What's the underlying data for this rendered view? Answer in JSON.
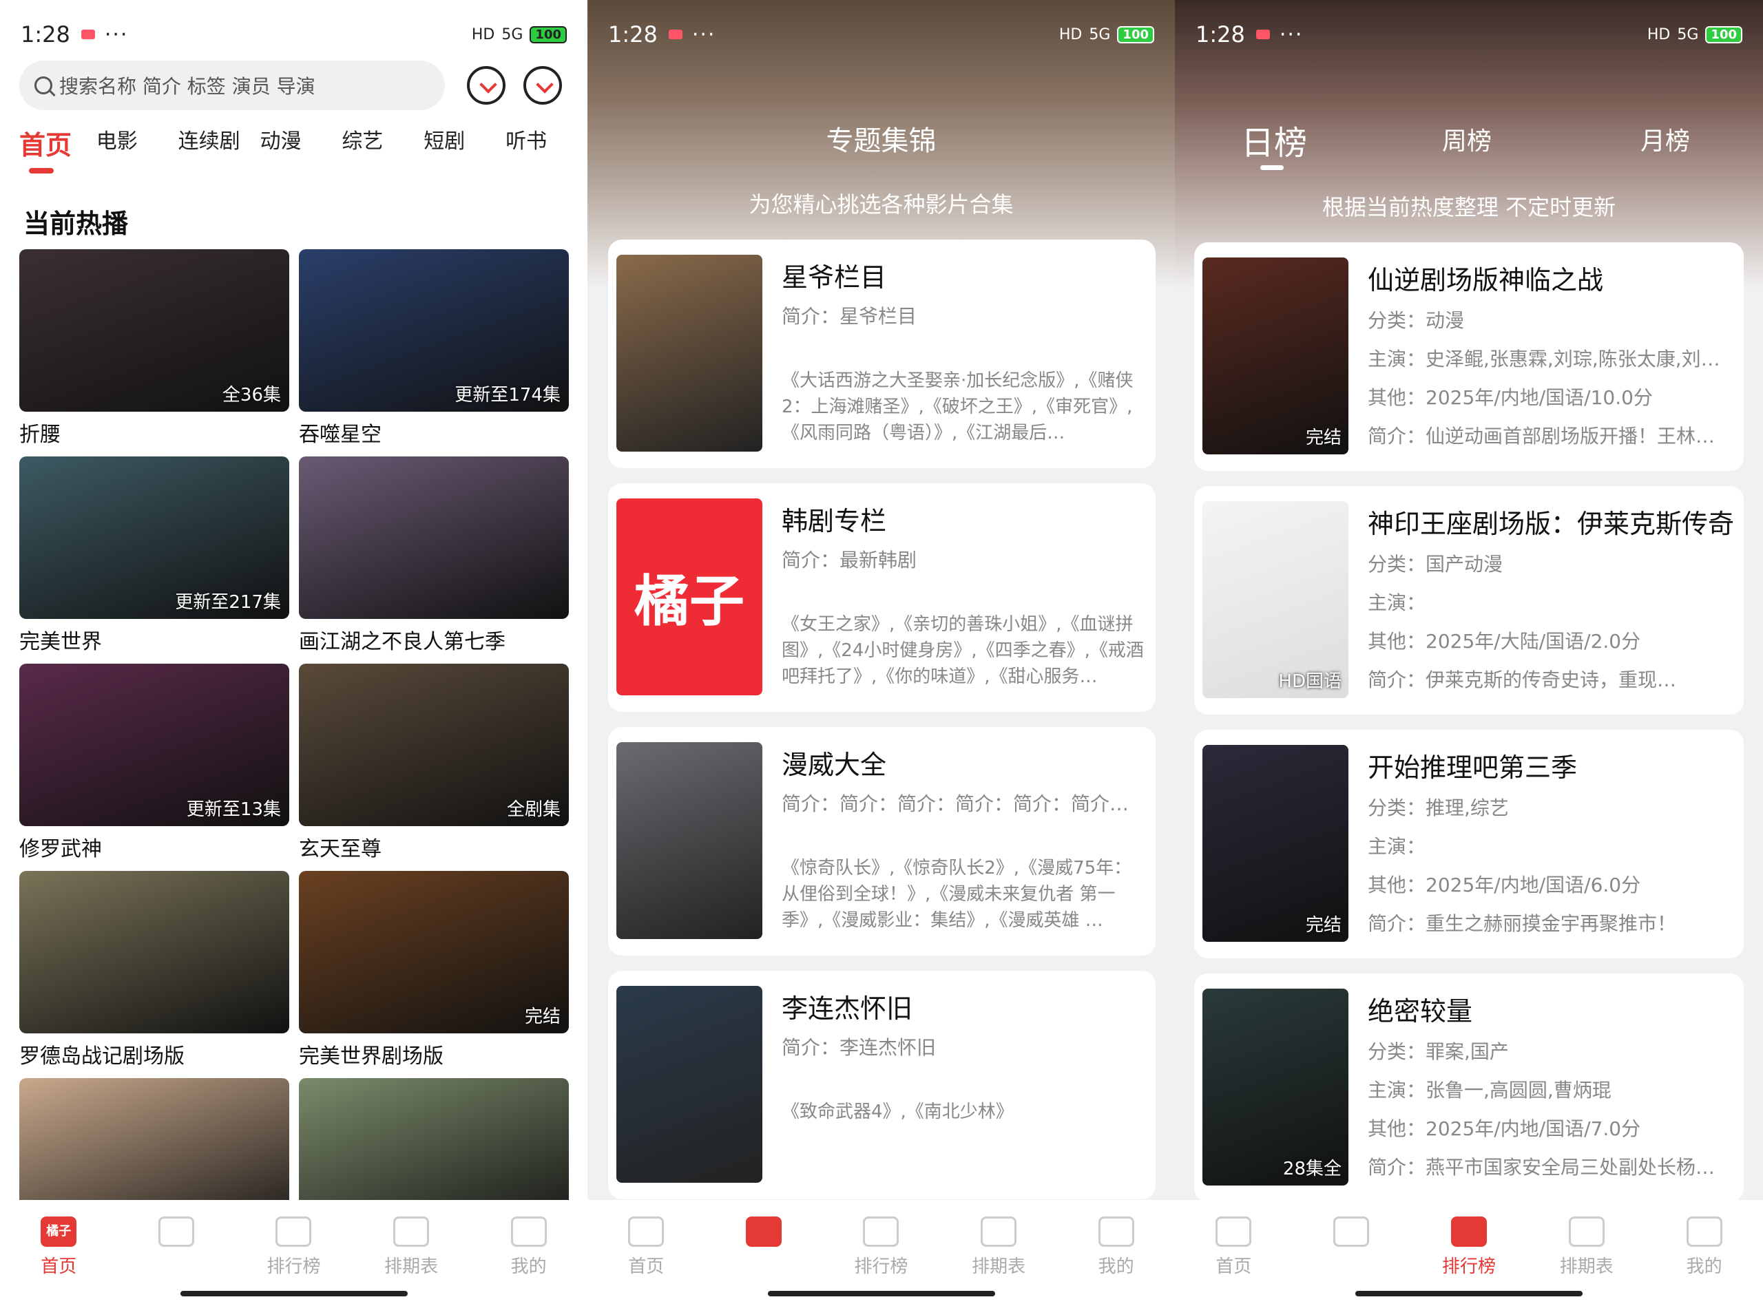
{
  "status": {
    "time": "1:28",
    "dots": "···",
    "battery": "100",
    "hd": "HD",
    "sig": "5G"
  },
  "home": {
    "search_placeholder": "搜索名称 简介 标签 演员 导演",
    "categories": [
      "首页",
      "电影",
      "连续剧",
      "动漫",
      "综艺",
      "短剧",
      "听书"
    ],
    "section_title": "当前热播",
    "items": [
      {
        "name": "折腰",
        "badge": "全36集",
        "color": "#3a2f35"
      },
      {
        "name": "吞噬星空",
        "badge": "更新至174集",
        "color": "#2a3f6a"
      },
      {
        "name": "完美世界",
        "badge": "更新至217集",
        "color": "#3d5a63"
      },
      {
        "name": "画江湖之不良人第七季",
        "badge": "",
        "color": "#6a5a74"
      },
      {
        "name": "修罗武神",
        "badge": "更新至13集",
        "color": "#5a2a4a"
      },
      {
        "name": "玄天至尊",
        "badge": "全剧集",
        "color": "#5a4a3a"
      },
      {
        "name": "罗德岛战记剧场版",
        "badge": "",
        "color": "#7a7358"
      },
      {
        "name": "完美世界剧场版",
        "badge": "完结",
        "color": "#6a4020"
      },
      {
        "name": "",
        "badge": "",
        "color": "#c9a98c"
      },
      {
        "name": "",
        "badge": "",
        "color": "#7a8a6a"
      }
    ]
  },
  "topics": {
    "title": "专题集锦",
    "subtitle": "为您精心挑选各种影片合集",
    "items": [
      {
        "title": "星爷栏目",
        "intro": "简介：星爷栏目",
        "list": "《大话西游之大圣娶亲·加长纪念版》,《赌侠2：上海滩赌圣》,《破坏之王》,《审死官》,《风雨同路（粤语）》,《江湖最后…",
        "color": "#8a6a4a"
      },
      {
        "title": "韩剧专栏",
        "intro": "简介：最新韩剧",
        "list": "《女王之家》,《亲切的善珠小姐》,《血谜拼图》,《24小时健身房》,《四季之春》,《戒酒吧拜托了》,《你的味道》,《甜心服务…",
        "logo": "橘子",
        "color": "#ef2b35"
      },
      {
        "title": "漫威大全",
        "intro": "简介：简介：简介：简介：简介：简介…",
        "list": "《惊奇队长》,《惊奇队长2》,《漫威75年：从俚俗到全球！》,《漫威未来复仇者 第一季》,《漫威影业：集结》,《漫威英雄 …",
        "color": "#6a6a70"
      },
      {
        "title": "李连杰怀旧",
        "intro": "简介：李连杰怀旧",
        "list": "《致命武器4》,《南北少林》",
        "color": "#2a3a4a"
      }
    ]
  },
  "ranking": {
    "tabs": [
      "日榜",
      "周榜",
      "月榜"
    ],
    "subtitle": "根据当前热度整理 不定时更新",
    "labels": {
      "cat": "分类：",
      "cast": "主演：",
      "other": "其他：",
      "intro": "简介："
    },
    "items": [
      {
        "title": "仙逆剧场版神临之战",
        "cat": "动漫",
        "cast": "史泽鲲,张惠霖,刘琮,陈张太康,刘…",
        "other": "2025年/内地/国语/10.0分",
        "intro": "仙逆动画首部剧场版开播！王林…",
        "badge": "完结",
        "color": "#5a2a20"
      },
      {
        "title": "神印王座剧场版：伊莱克斯传奇",
        "cat": "国产动漫",
        "cast": "",
        "other": "2025年/大陆/国语/2.0分",
        "intro": "伊莱克斯的传奇史诗，重现…",
        "badge": "HD国语",
        "color": "#f4f4f4"
      },
      {
        "title": "开始推理吧第三季",
        "cat": "推理,综艺",
        "cast": "",
        "other": "2025年/内地/国语/6.0分",
        "intro": "重生之赫丽摸金宇再聚推市！",
        "badge": "完结",
        "color": "#2a2a3a"
      },
      {
        "title": "绝密较量",
        "cat": "罪案,国产",
        "cast": "张鲁一,高圆圆,曹炳琨",
        "other": "2025年/内地/国语/7.0分",
        "intro": "燕平市国家安全局三处副处长杨…",
        "badge": "28集全",
        "color": "#2a3a3a"
      }
    ]
  },
  "tabbar": {
    "p1": [
      "首页",
      "",
      "排行榜",
      "排期表",
      "我的"
    ],
    "p2": [
      "首页",
      "",
      "排行榜",
      "排期表",
      "我的"
    ],
    "p3": [
      "首页",
      "",
      "排行榜",
      "排期表",
      "我的"
    ],
    "logo": "橘子"
  },
  "colors": {
    "accent": "#e53935"
  }
}
